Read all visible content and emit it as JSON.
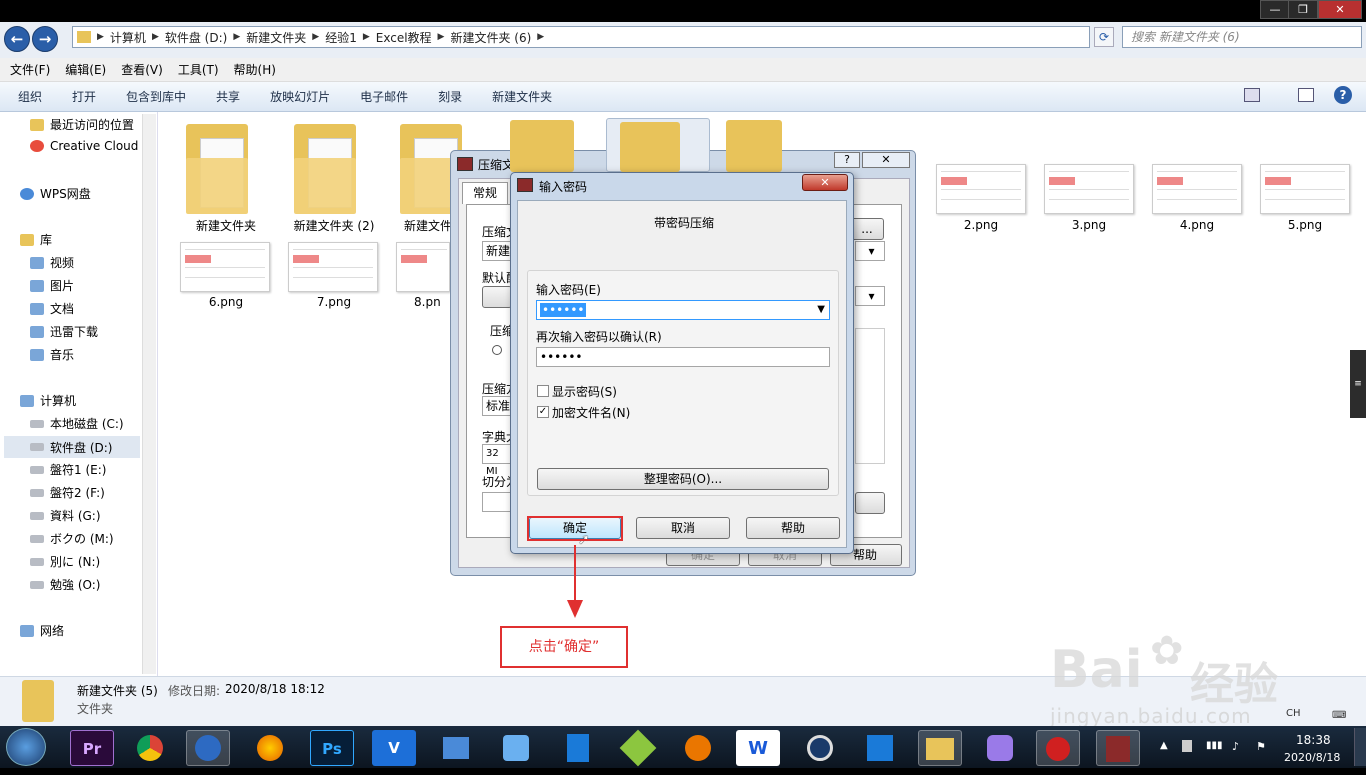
{
  "window": {
    "minimize": "—",
    "maximize": "❐",
    "close": "✕"
  },
  "address": {
    "crumbs": [
      "计算机",
      "软件盘 (D:)",
      "新建文件夹",
      "经验1",
      "Excel教程",
      "新建文件夹 (6)"
    ],
    "search_placeholder": "搜索 新建文件夹 (6)"
  },
  "menu": [
    "文件(F)",
    "编辑(E)",
    "查看(V)",
    "工具(T)",
    "帮助(H)"
  ],
  "toolbar": [
    "组织",
    "打开",
    "包含到库中",
    "共享",
    "放映幻灯片",
    "电子邮件",
    "刻录",
    "新建文件夹"
  ],
  "nav": {
    "items": [
      "最近访问的位置",
      "Creative Cloud",
      "WPS网盘",
      "库",
      "视频",
      "图片",
      "文档",
      "迅雷下载",
      "音乐",
      "计算机",
      "本地磁盘 (C:)",
      "软件盘 (D:)",
      "盤符1 (E:)",
      "盤符2 (F:)",
      "資料 (G:)",
      "ボクの (M:)",
      "別に (N:)",
      "勉強 (O:)",
      "网络"
    ]
  },
  "files": {
    "folders": [
      "新建文件夹",
      "新建文件夹 (2)",
      "新建文件"
    ],
    "images_top": [
      "2.png",
      "3.png",
      "4.png",
      "5.png"
    ],
    "images_bottom": [
      "6.png",
      "7.png",
      "8.pn"
    ]
  },
  "status": {
    "name": "新建文件夹 (5)",
    "modified_label": "修改日期:",
    "modified": "2020/8/18 18:12",
    "type": "文件夹"
  },
  "outer_dialog": {
    "title": "压缩文件名和参数",
    "tab": "常规",
    "frag": [
      "压缩文",
      "新建",
      "默认配",
      "压缩",
      "压缩方",
      "标准",
      "字典大",
      "32 MI",
      "切分为"
    ],
    "btn_frag": [
      "确定",
      "取消",
      "帮助"
    ]
  },
  "password_dialog": {
    "title": "输入密码",
    "heading": "带密码压缩",
    "pw_label": "输入密码(E)",
    "pw_value": "••••••",
    "confirm_label": "再次输入密码以确认(R)",
    "confirm_value": "••••••",
    "show_pw": "显示密码(S)",
    "encrypt_names": "加密文件名(N)",
    "organize": "整理密码(O)...",
    "ok": "确定",
    "cancel": "取消",
    "help": "帮助"
  },
  "annotation": {
    "note": "点击“确定”"
  },
  "taskbar": {
    "apps": [
      "Pr",
      "Ps",
      "W"
    ],
    "time": "18:38",
    "date": "2020/8/18",
    "lang": "CH"
  },
  "watermark": {
    "brand": "Bai",
    "brand2": "经验",
    "url": "jingyan.baidu.com"
  }
}
